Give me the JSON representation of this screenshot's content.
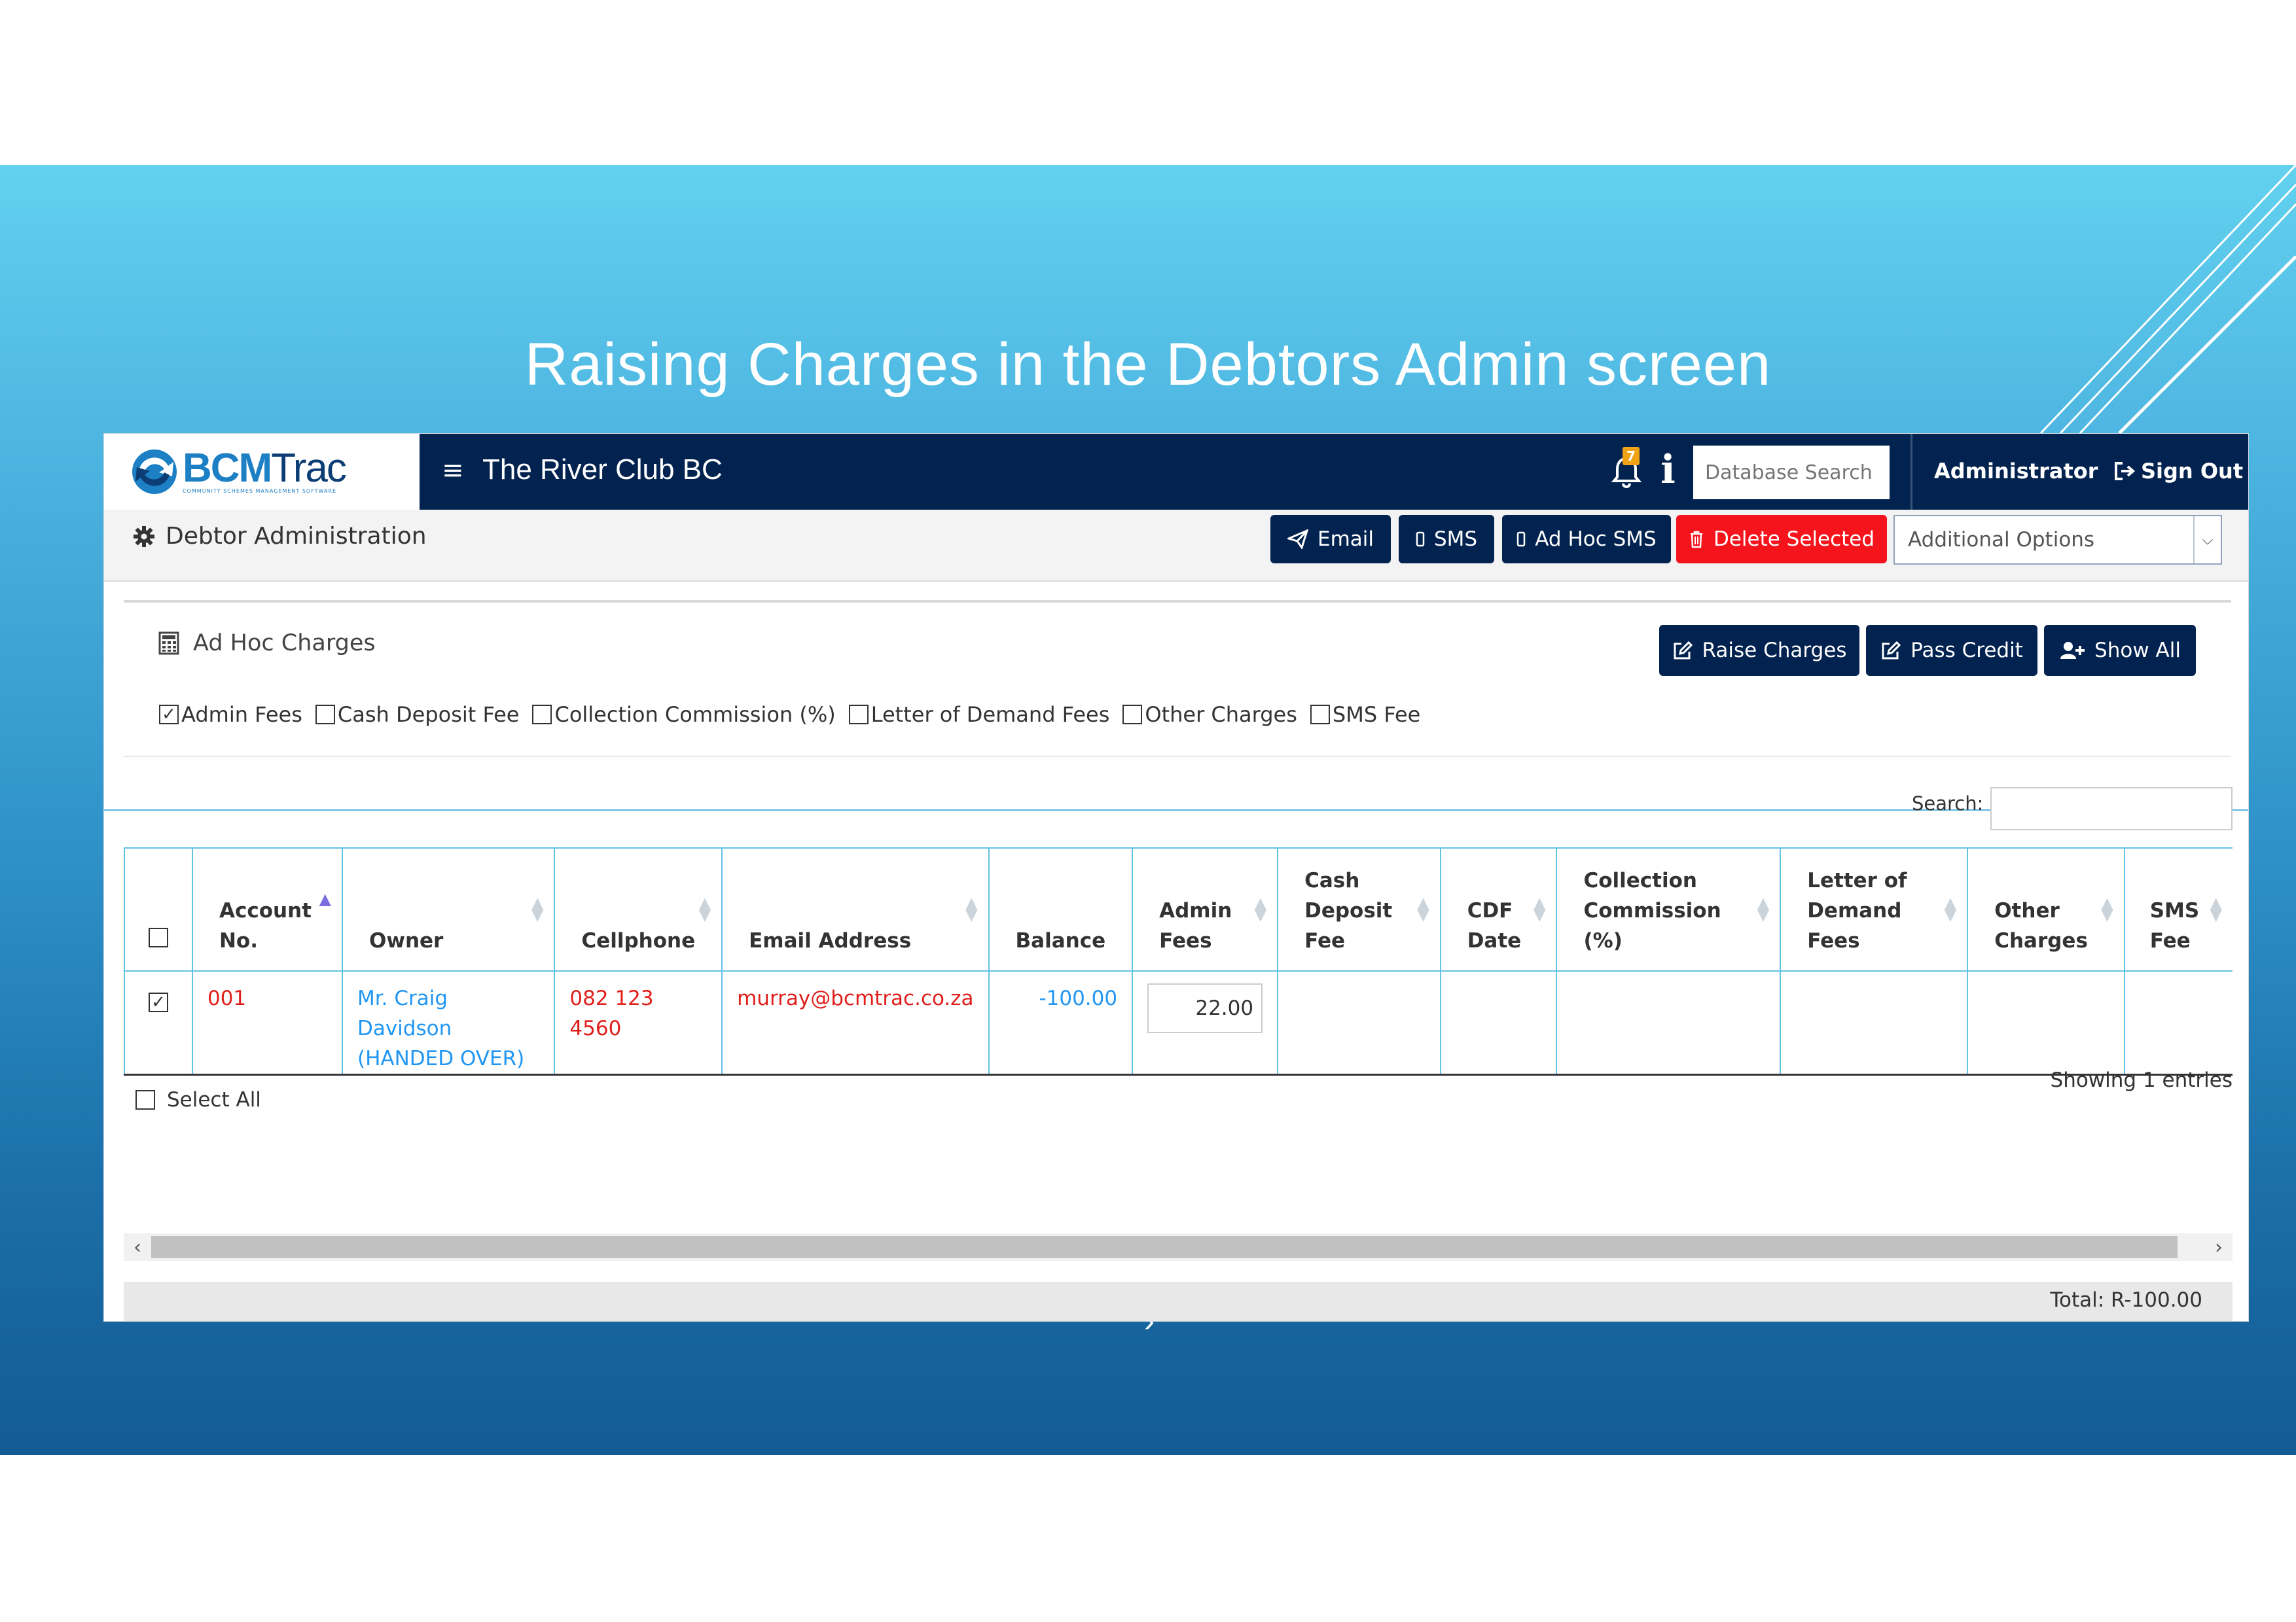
{
  "slide": {
    "title": "Raising Charges in the Debtors Admin screen",
    "stray_mark": "›"
  },
  "topbar": {
    "logo_text_a": "BCM",
    "logo_text_b": "Trac",
    "logo_subtext": "COMMUNITY SCHEMES MANAGEMENT SOFTWARE",
    "club_name": "The River Club BC",
    "notification_count": "7",
    "search_placeholder": "Database Search",
    "user_label": "Administrator",
    "signout_label": "Sign Out",
    "colors": {
      "navbar": "#02224f",
      "badge": "#f0a317"
    }
  },
  "subbar": {
    "heading": "Debtor Administration",
    "buttons": {
      "email": "Email",
      "sms": "SMS",
      "adhoc_sms": "Ad Hoc SMS",
      "delete": "Delete Selected"
    },
    "options_value": "Additional Options",
    "colors": {
      "delete": "#f5141c"
    }
  },
  "adhoc": {
    "title": "Ad Hoc Charges",
    "buttons": {
      "raise": "Raise Charges",
      "pass_credit": "Pass Credit",
      "show_all": "Show All"
    },
    "checkboxes": [
      {
        "label": "Admin Fees",
        "checked": true
      },
      {
        "label": "Cash Deposit Fee",
        "checked": false
      },
      {
        "label": "Collection Commission (%)",
        "checked": false
      },
      {
        "label": "Letter of Demand Fees",
        "checked": false
      },
      {
        "label": "Other Charges",
        "checked": false
      },
      {
        "label": "SMS Fee",
        "checked": false
      }
    ]
  },
  "table": {
    "search_label": "Search:",
    "headers": {
      "account": [
        "Account",
        "No."
      ],
      "owner": "Owner",
      "cellphone": "Cellphone",
      "email": "Email Address",
      "balance": "Balance",
      "admin": [
        "Admin",
        "Fees"
      ],
      "cash": [
        "Cash",
        "Deposit",
        "Fee"
      ],
      "cdf": [
        "CDF",
        "Date"
      ],
      "collection": [
        "Collection",
        "Commission (%)"
      ],
      "letter": [
        "Letter of",
        "Demand Fees"
      ],
      "other": [
        "Other",
        "Charges"
      ],
      "sms": [
        "SMS",
        "Fee"
      ]
    },
    "rows": [
      {
        "checked": true,
        "account": "001",
        "owner": [
          "Mr. Craig Davidson",
          "(HANDED OVER)"
        ],
        "cellphone": [
          "082 123",
          "4560"
        ],
        "email": "murray@bcmtrac.co.za",
        "balance": "-100.00",
        "admin_fee_value": "22.00"
      }
    ],
    "select_all": "Select All",
    "showing": "Showing 1 entries",
    "total": "Total: R-100.00"
  }
}
